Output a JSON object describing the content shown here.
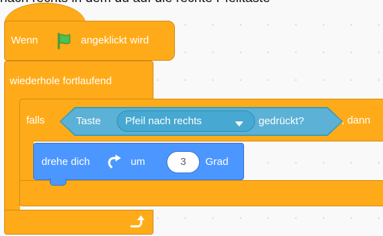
{
  "page_header": "nach rechts in dem du auf die rechte Pfeiltaste",
  "colors": {
    "events": "#ffab19",
    "control": "#ffab19",
    "sensing": "#5cb1d6",
    "motion": "#4c97ff",
    "flag": "#4cbf56",
    "background": "#f9f9f9"
  },
  "hat_block": {
    "prefix": "Wenn",
    "icon": "green-flag-icon",
    "suffix": "angeklickt wird"
  },
  "forever_block": {
    "label": "wiederhole fortlaufend",
    "icon": "loop-arrow-icon"
  },
  "if_block": {
    "label": "falls",
    "then_label": ", dann"
  },
  "sensing_block": {
    "prefix": "Taste",
    "key_selected": "Pfeil nach rechts",
    "dropdown_icon": "dropdown-caret-icon",
    "suffix": "gedrückt?"
  },
  "turn_block": {
    "prefix": "drehe dich",
    "icon": "rotate-clockwise-icon",
    "middle": "um",
    "value": "3",
    "suffix": "Grad"
  }
}
